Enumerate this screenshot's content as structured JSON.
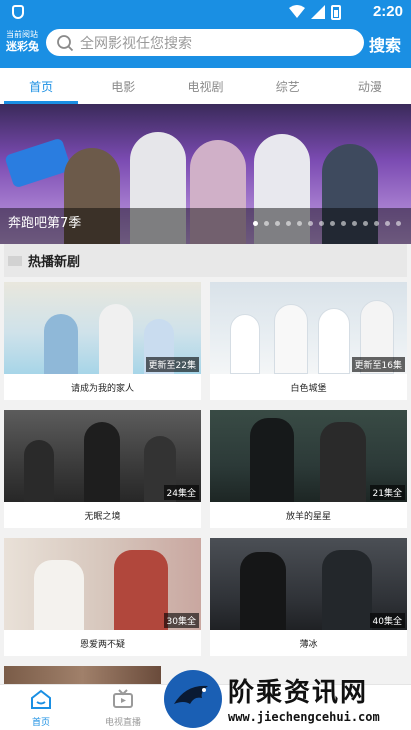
{
  "status_bar": {
    "time": "2:20"
  },
  "header": {
    "location_label": "当前阅站",
    "location_name": "迷彩兔",
    "search_placeholder": "全网影视任您搜索",
    "search_button": "搜索"
  },
  "tabs": [
    {
      "label": "首页"
    },
    {
      "label": "电影"
    },
    {
      "label": "电视剧"
    },
    {
      "label": "综艺"
    },
    {
      "label": "动漫"
    }
  ],
  "banner": {
    "title": "奔跑吧第7季",
    "dot_count": 14,
    "active_dot": 0
  },
  "section": {
    "title": "热播新剧"
  },
  "cards": [
    {
      "title": "请成为我的家人",
      "badge": "更新至22集"
    },
    {
      "title": "白色城堡",
      "badge": "更新至16集"
    },
    {
      "title": "无眠之境",
      "badge": "24集全"
    },
    {
      "title": "放羊的星星",
      "badge": "21集全"
    },
    {
      "title": "恩爱两不疑",
      "badge": "30集全"
    },
    {
      "title": "薄冰",
      "badge": "40集全"
    }
  ],
  "bottom_nav": [
    {
      "label": "首页",
      "icon": "home-icon"
    },
    {
      "label": "电视直播",
      "icon": "tv-icon"
    }
  ],
  "watermark": {
    "text": "阶乘资讯网",
    "url": "www.jiechengcehui.com"
  },
  "colors": {
    "accent": "#1a8fe3",
    "background": "#f2f2f2"
  }
}
